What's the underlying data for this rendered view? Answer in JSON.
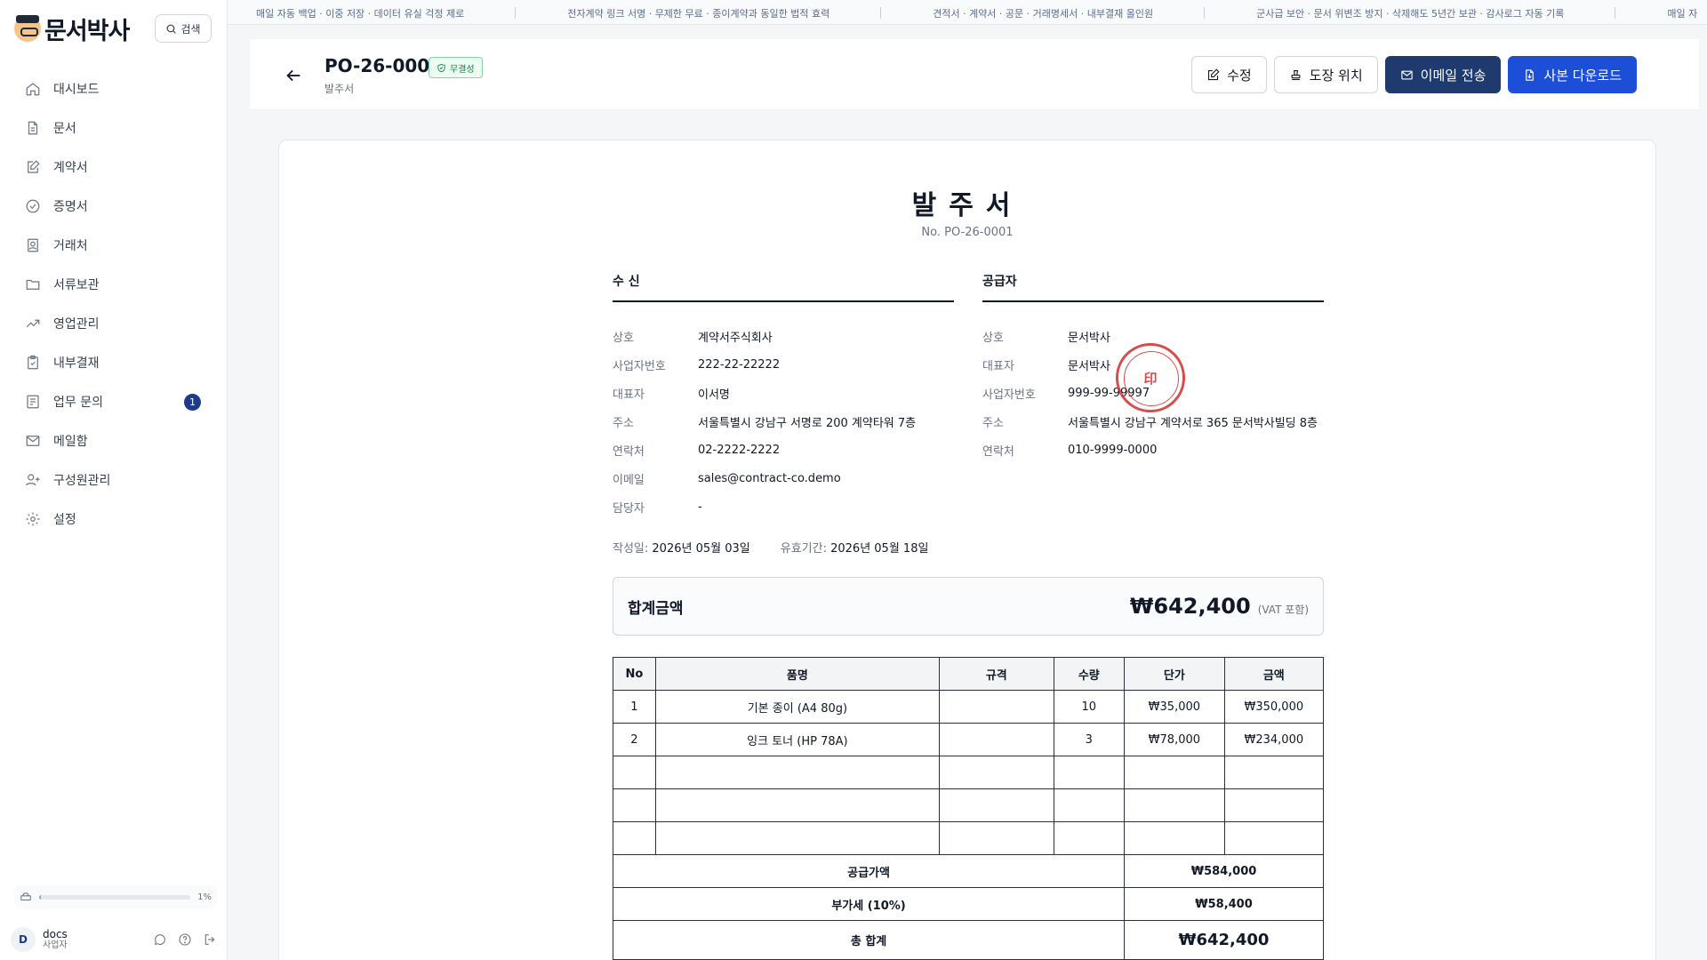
{
  "app": {
    "brand": "문서박사",
    "search_label": "검색"
  },
  "sidebar": {
    "items": [
      {
        "label": "대시보드",
        "icon": "home-icon"
      },
      {
        "label": "문서",
        "icon": "document-icon"
      },
      {
        "label": "계약서",
        "icon": "edit-doc-icon"
      },
      {
        "label": "증명서",
        "icon": "check-circle-icon"
      },
      {
        "label": "거래처",
        "icon": "contact-icon"
      },
      {
        "label": "서류보관",
        "icon": "folder-icon"
      },
      {
        "label": "영업관리",
        "icon": "trending-icon"
      },
      {
        "label": "내부결재",
        "icon": "clipboard-icon"
      },
      {
        "label": "업무 문의",
        "icon": "inquiry-icon",
        "badge": "1"
      },
      {
        "label": "메일함",
        "icon": "mail-icon"
      },
      {
        "label": "구성원관리",
        "icon": "user-plus-icon"
      },
      {
        "label": "설정",
        "icon": "gear-icon"
      }
    ],
    "storage": {
      "percent_label": "1%",
      "fill_fraction": 0.01
    },
    "user": {
      "initial": "D",
      "name": "docs",
      "role": "사업자"
    }
  },
  "marquee": [
    "매일 자동 백업 · 이중 저장 · 데이터 유실 걱정 제로",
    "전자계약 링크 서명 · 무제한 무료 · 종이계약과 동일한 법적 효력",
    "견적서 · 계약서 · 공문 · 거래명세서 · 내부결재 올인원",
    "군사급 보안 · 문서 위변조 방지 · 삭제해도 5년간 보관 · 감사로그 자동 기록",
    "매일 자"
  ],
  "header": {
    "doc_id": "PO-26-0001",
    "integrity_badge": "무결성",
    "doc_type": "발주서",
    "buttons": {
      "edit": "수정",
      "stamp": "도장 위치",
      "email": "이메일 전송",
      "download": "사본 다운로드"
    }
  },
  "document": {
    "title": "발주서",
    "number": "No. PO-26-0001",
    "recipient": {
      "heading": "수 신",
      "rows": [
        {
          "k": "상호",
          "v": "계약서주식회사"
        },
        {
          "k": "사업자번호",
          "v": "222-22-22222"
        },
        {
          "k": "대표자",
          "v": "이서명"
        },
        {
          "k": "주소",
          "v": "서울특별시 강남구 서명로 200 계약타워 7층"
        },
        {
          "k": "연락처",
          "v": "02-2222-2222"
        },
        {
          "k": "이메일",
          "v": "sales@contract-co.demo"
        },
        {
          "k": "담당자",
          "v": "-"
        }
      ]
    },
    "supplier": {
      "heading": "공급자",
      "rows": [
        {
          "k": "상호",
          "v": "문서박사"
        },
        {
          "k": "대표자",
          "v": "문서박사"
        },
        {
          "k": "사업자번호",
          "v": "999-99-99997"
        },
        {
          "k": "주소",
          "v": "서울특별시 강남구 계약서로 365 문서박사빌딩 8층"
        },
        {
          "k": "연락처",
          "v": "010-9999-0000"
        }
      ],
      "seal_text": "印"
    },
    "dates": {
      "written_label": "작성일:",
      "written": "2026년 05월 03일",
      "valid_label": "유효기간:",
      "valid": "2026년 05월 18일"
    },
    "total": {
      "label": "합계금액",
      "amount": "₩642,400",
      "vat_note": "(VAT 포함)"
    },
    "table": {
      "headers": [
        "No",
        "품명",
        "규격",
        "수량",
        "단가",
        "금액"
      ],
      "rows": [
        [
          "1",
          "기본 종이 (A4 80g)",
          "",
          "10",
          "₩35,000",
          "₩350,000"
        ],
        [
          "2",
          "잉크 토너 (HP 78A)",
          "",
          "3",
          "₩78,000",
          "₩234,000"
        ],
        [
          "",
          "",
          "",
          "",
          "",
          ""
        ],
        [
          "",
          "",
          "",
          "",
          "",
          ""
        ],
        [
          "",
          "",
          "",
          "",
          "",
          ""
        ]
      ],
      "supply_label": "공급가액",
      "supply_value": "₩584,000",
      "vat_label": "부가세 (10%)",
      "vat_value": "₩58,400",
      "grand_label": "총 합계",
      "grand_value": "₩642,400"
    }
  }
}
